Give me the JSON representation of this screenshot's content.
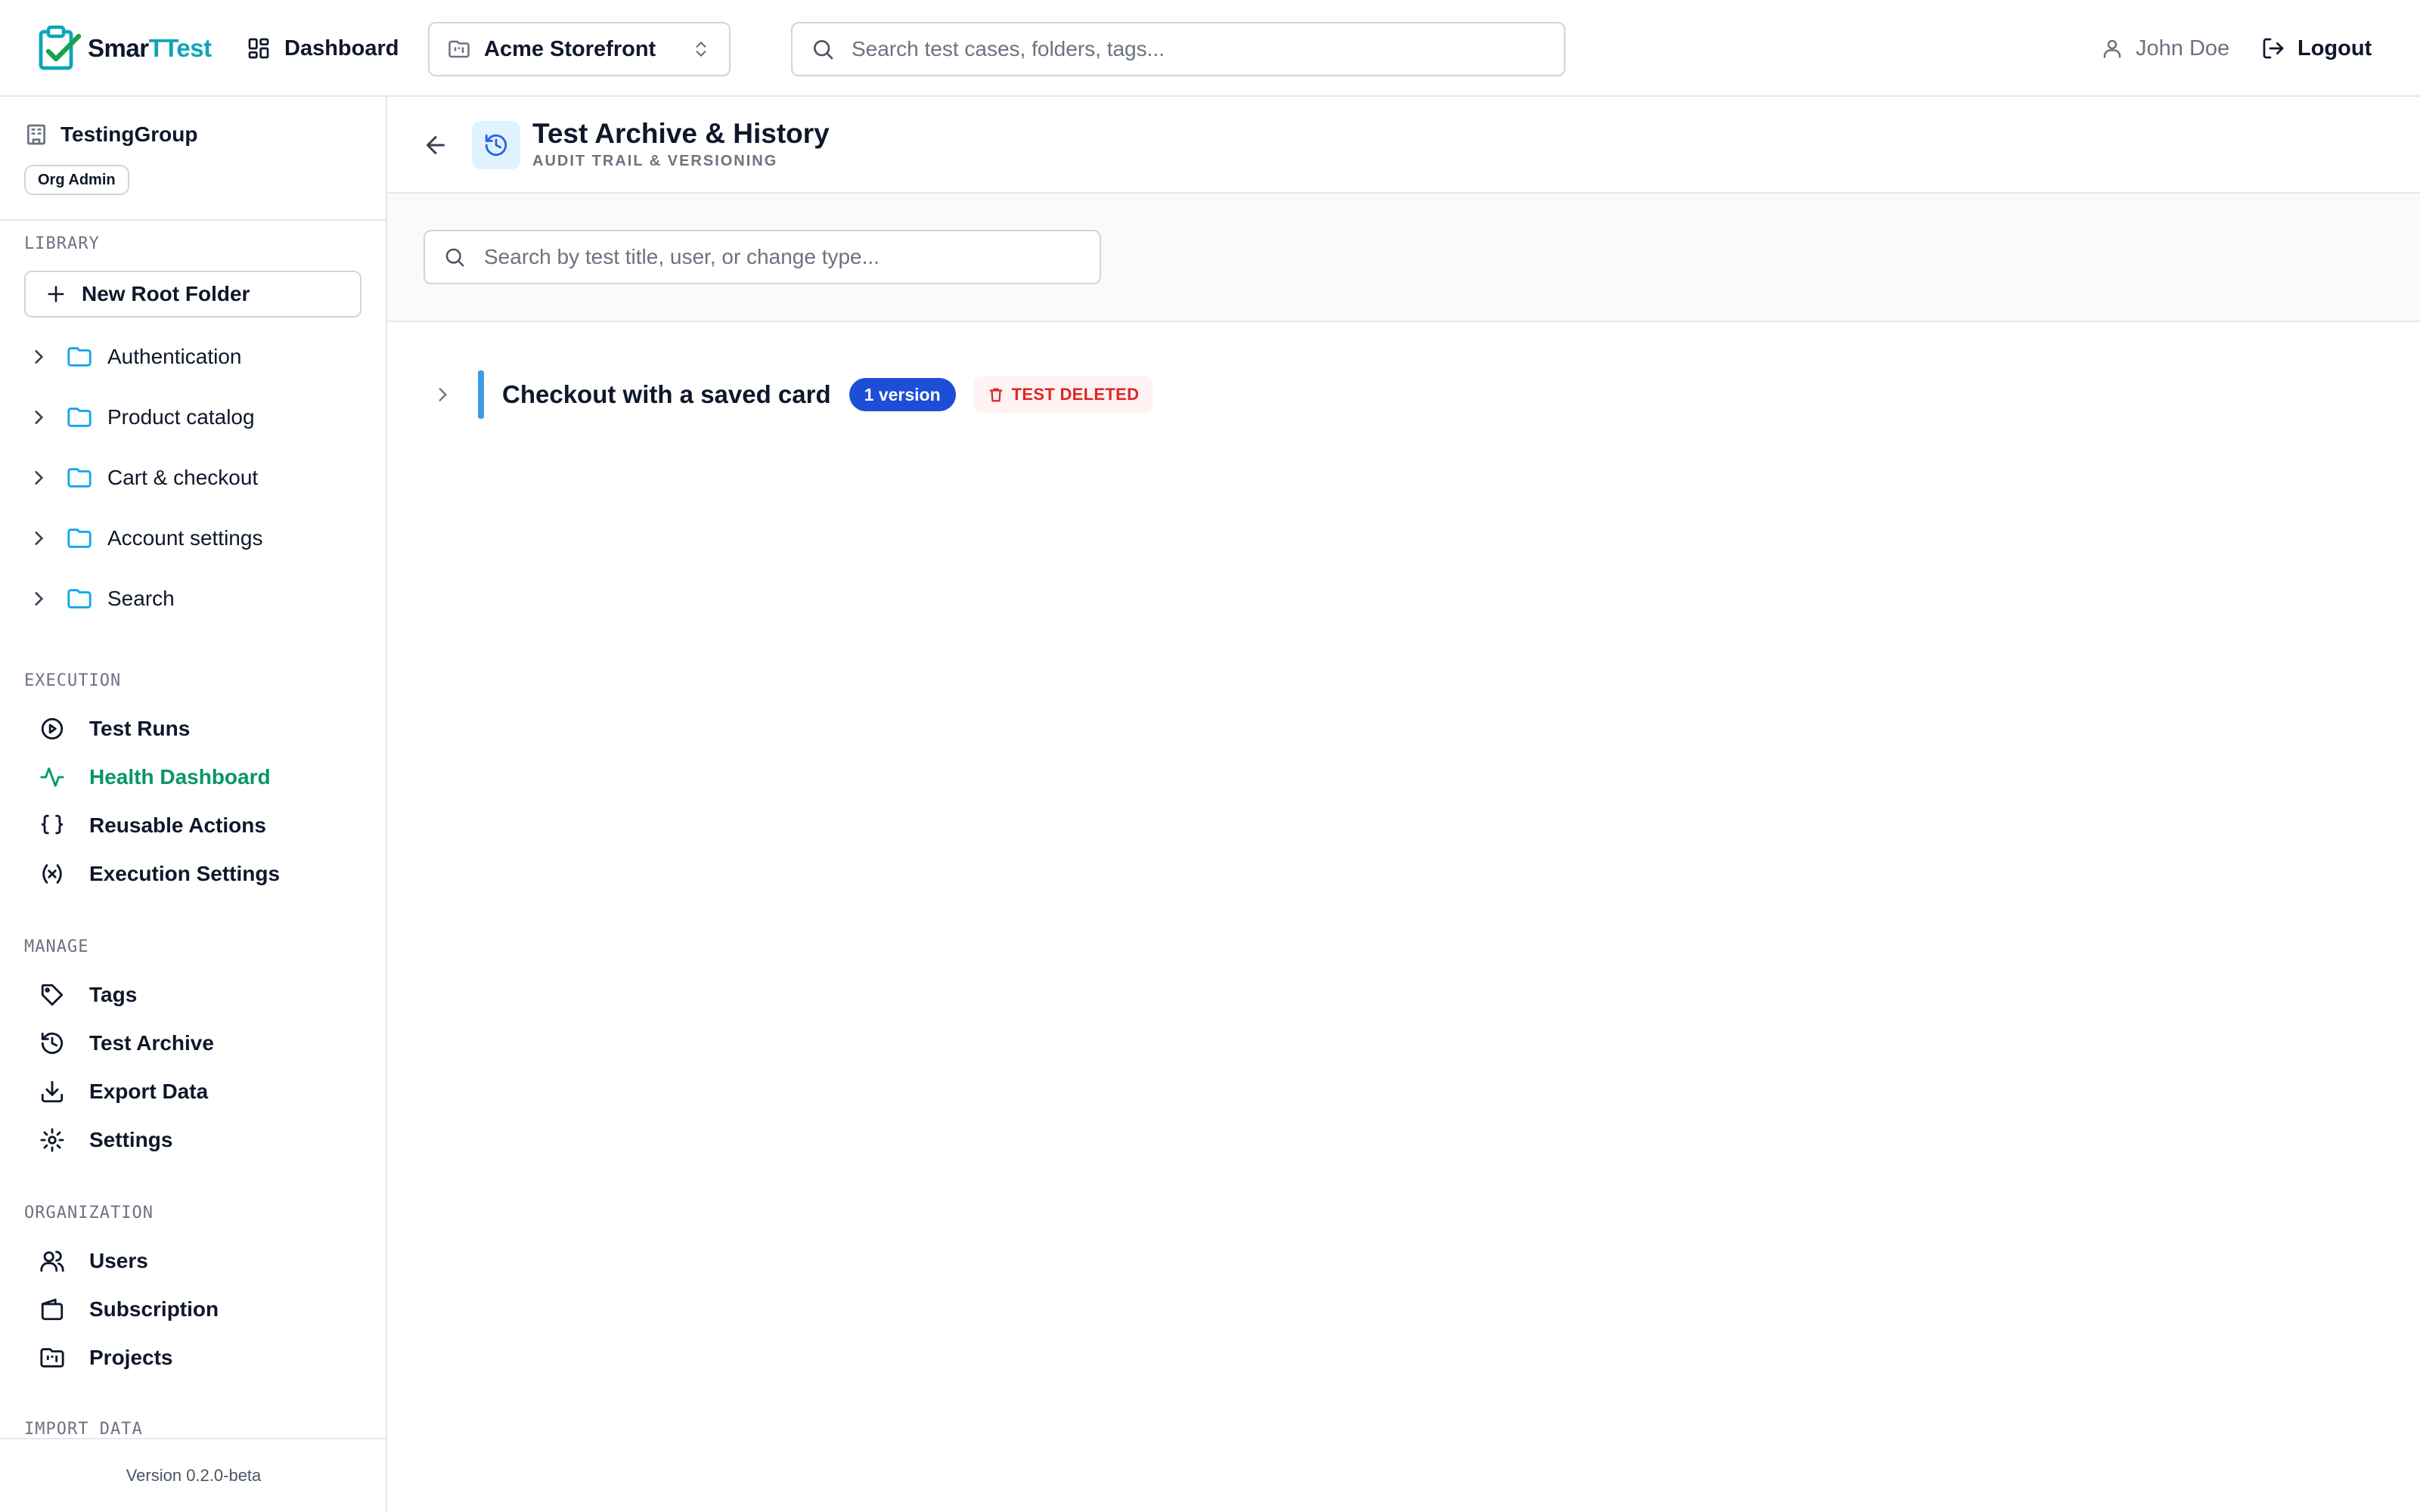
{
  "app": {
    "logo_prefix": "Smar",
    "logo_accent": "TTest",
    "brand_color": "#0ea5b7"
  },
  "topbar": {
    "dashboard_label": "Dashboard",
    "project_selected": "Acme Storefront",
    "search_placeholder": "Search test cases, folders, tags...",
    "user_name": "John Doe",
    "logout_label": "Logout"
  },
  "sidebar": {
    "org_name": "TestingGroup",
    "role_badge": "Org Admin",
    "library": {
      "label": "LIBRARY",
      "new_folder_label": "New Root Folder",
      "folders": [
        {
          "label": "Authentication"
        },
        {
          "label": "Product catalog"
        },
        {
          "label": "Cart & checkout"
        },
        {
          "label": "Account settings"
        },
        {
          "label": "Search"
        }
      ]
    },
    "execution": {
      "label": "EXECUTION",
      "items": [
        {
          "label": "Test Runs",
          "icon": "play-circle-icon"
        },
        {
          "label": "Health Dashboard",
          "icon": "activity-icon",
          "active": true
        },
        {
          "label": "Reusable Actions",
          "icon": "braces-icon"
        },
        {
          "label": "Execution Settings",
          "icon": "variable-icon"
        }
      ]
    },
    "manage": {
      "label": "MANAGE",
      "items": [
        {
          "label": "Tags",
          "icon": "tag-icon"
        },
        {
          "label": "Test Archive",
          "icon": "history-icon"
        },
        {
          "label": "Export Data",
          "icon": "download-icon"
        },
        {
          "label": "Settings",
          "icon": "gear-icon"
        }
      ]
    },
    "organization": {
      "label": "ORGANIZATION",
      "items": [
        {
          "label": "Users",
          "icon": "users-icon"
        },
        {
          "label": "Subscription",
          "icon": "wallet-icon"
        },
        {
          "label": "Projects",
          "icon": "folder-kanban-icon"
        }
      ]
    },
    "import_label": "IMPORT DATA",
    "version": "Version 0.2.0-beta",
    "active_color": "#059669"
  },
  "page": {
    "title": "Test Archive & History",
    "subtitle": "AUDIT TRAIL & VERSIONING",
    "search_placeholder": "Search by test title, user, or change type..."
  },
  "history": [
    {
      "title": "Checkout with a saved card",
      "version_badge": "1 version",
      "status_badge": "TEST DELETED",
      "status_color": "#dc2626",
      "version_color": "#1d4ed8",
      "accent_color": "#3b9ee5"
    }
  ]
}
